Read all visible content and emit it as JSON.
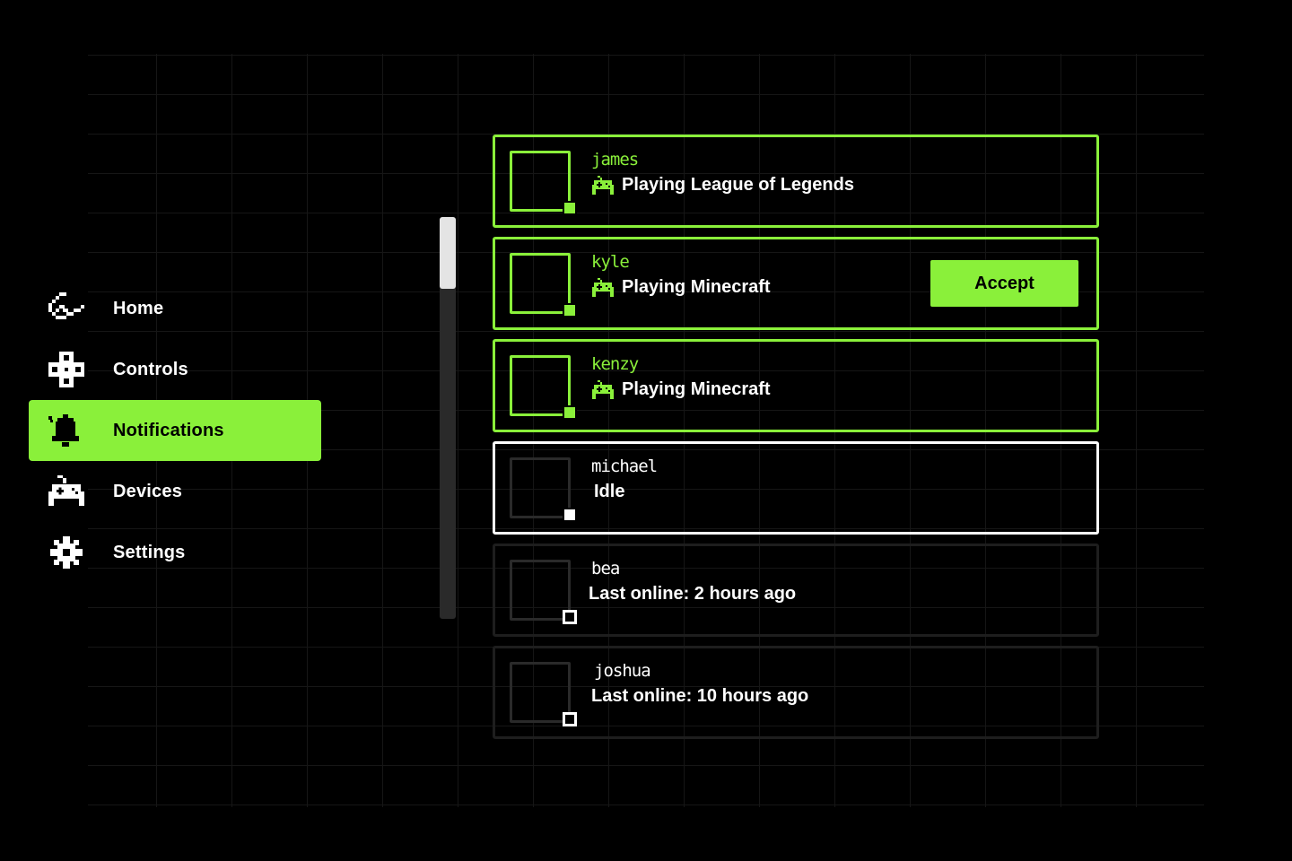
{
  "colors": {
    "accent": "#8af03a",
    "background": "#000000",
    "text": "#ffffff",
    "offline_border": "#1e1e1e"
  },
  "sidebar": {
    "items": [
      {
        "label": "Home",
        "icon": "swoosh-icon",
        "active": false
      },
      {
        "label": "Controls",
        "icon": "dpad-icon",
        "active": false
      },
      {
        "label": "Notifications",
        "icon": "bell-icon",
        "active": true
      },
      {
        "label": "Devices",
        "icon": "gamepad-icon",
        "active": false
      },
      {
        "label": "Settings",
        "icon": "gear-icon",
        "active": false
      }
    ]
  },
  "scrollbar": {
    "position": 0.0
  },
  "friends": [
    {
      "username": "james",
      "status": "Playing League of Legends",
      "state": "playing",
      "icon": "gamepad-icon"
    },
    {
      "username": "kyle",
      "status": "Playing Minecraft",
      "state": "playing",
      "icon": "gamepad-icon",
      "action": "Accept"
    },
    {
      "username": "kenzy",
      "status": "Playing Minecraft",
      "state": "playing",
      "icon": "gamepad-icon"
    },
    {
      "username": "michael",
      "status": "Idle",
      "state": "idle"
    },
    {
      "username": "bea",
      "status": "Last online: 2 hours ago",
      "state": "offline"
    },
    {
      "username": "joshua",
      "status": "Last online: 10 hours ago",
      "state": "offline"
    }
  ]
}
